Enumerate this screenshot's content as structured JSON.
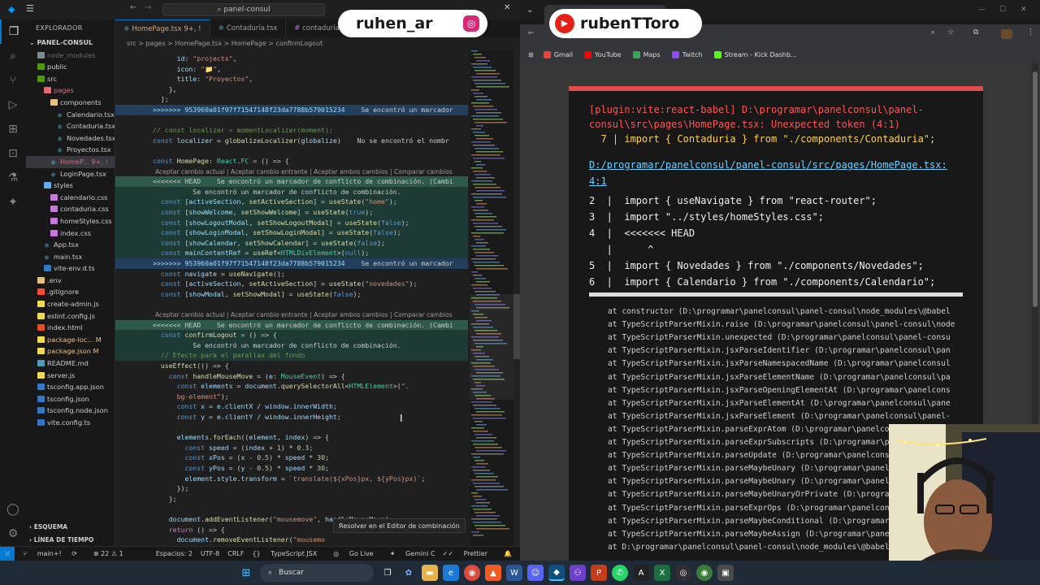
{
  "vscode": {
    "search": "panel-consul",
    "explorer_title": "EXPLORADOR",
    "project": "PANEL-CONSUL",
    "tree": [
      {
        "label": "node_modules",
        "indent": 1,
        "kind": "folder",
        "color": "#7f8c8d",
        "dim": true
      },
      {
        "label": "public",
        "indent": 1,
        "kind": "folder",
        "color": "#4e9a06"
      },
      {
        "label": "src",
        "indent": 1,
        "kind": "folder",
        "color": "#4e9a06",
        "open": true
      },
      {
        "label": "pages",
        "indent": 2,
        "kind": "folder",
        "color": "#e06c75",
        "open": true,
        "red": true
      },
      {
        "label": "components",
        "indent": 3,
        "kind": "folder",
        "color": "#e5c07b",
        "open": true
      },
      {
        "label": "Calendario.tsx",
        "indent": 4,
        "kind": "react"
      },
      {
        "label": "Contaduria.tsx",
        "indent": 4,
        "kind": "react"
      },
      {
        "label": "Novedades.tsx",
        "indent": 4,
        "kind": "react"
      },
      {
        "label": "Proyectos.tsx",
        "indent": 4,
        "kind": "react"
      },
      {
        "label": "HomeP... 9+, !",
        "indent": 3,
        "kind": "react",
        "selected": true,
        "red": true
      },
      {
        "label": "LoginPage.tsx",
        "indent": 3,
        "kind": "react"
      },
      {
        "label": "styles",
        "indent": 2,
        "kind": "folder",
        "color": "#61afef",
        "open": true
      },
      {
        "label": "calendario.css",
        "indent": 3,
        "kind": "css"
      },
      {
        "label": "contaduria.css",
        "indent": 3,
        "kind": "css"
      },
      {
        "label": "homeStyles.css",
        "indent": 3,
        "kind": "css"
      },
      {
        "label": "index.css",
        "indent": 3,
        "kind": "css"
      },
      {
        "label": "App.tsx",
        "indent": 2,
        "kind": "react"
      },
      {
        "label": "main.tsx",
        "indent": 2,
        "kind": "react"
      },
      {
        "label": "vite-env.d.ts",
        "indent": 2,
        "kind": "ts"
      },
      {
        "label": ".env",
        "indent": 1,
        "kind": "cfg"
      },
      {
        "label": ".gitignore",
        "indent": 1,
        "kind": "git"
      },
      {
        "label": "create-admin.js",
        "indent": 1,
        "kind": "js"
      },
      {
        "label": "eslint.config.js",
        "indent": 1,
        "kind": "js"
      },
      {
        "label": "index.html",
        "indent": 1,
        "kind": "html"
      },
      {
        "label": "package-loc... M",
        "indent": 1,
        "kind": "json",
        "mod": true
      },
      {
        "label": "package.json  M",
        "indent": 1,
        "kind": "json",
        "mod": true
      },
      {
        "label": "README.md",
        "indent": 1,
        "kind": "md"
      },
      {
        "label": "server.js",
        "indent": 1,
        "kind": "js"
      },
      {
        "label": "tsconfig.app.json",
        "indent": 1,
        "kind": "ts"
      },
      {
        "label": "tsconfig.json",
        "indent": 1,
        "kind": "ts"
      },
      {
        "label": "tsconfig.node.json",
        "indent": 1,
        "kind": "ts"
      },
      {
        "label": "vite.config.ts",
        "indent": 1,
        "kind": "ts"
      }
    ],
    "outline_label": "ESQUEMA",
    "timeline_label": "LÍNEA DE TIEMPO",
    "tabs": [
      "HomePage.tsx 9+, !",
      "Contaduria.tsx",
      "contaduria"
    ],
    "breadcrumb": "src > pages > HomePage.tsx > HomePage > confirmLogout",
    "conflict_actions": "Aceptar cambio actual | Aceptar cambio entrante | Aceptar ambos cambios | Comparar cambios",
    "conflict_msg": "Se encontró un marcador de conflicto de combinación.",
    "merge_button": "Resolver en el Editor de combinación",
    "status": {
      "branch": "main+!",
      "sync": "⟳",
      "problems": "⊗ 22 ⚠ 1",
      "spaces": "Espacios: 2",
      "encoding": "UTF-8",
      "eol": "CRLF",
      "lang": "TypeScript JSX",
      "golive": "Go Live",
      "gemini": "Gemini Code Assist: Indexing workspace...",
      "prettier": "Prettier"
    },
    "code_lines": [
      {
        "n": "",
        "h": "",
        "html": "      <span class='v'>id</span>: <span class='s'>\"projects\"</span>,"
      },
      {
        "n": "",
        "h": "",
        "html": "      <span class='v'>icon</span>: <span class='s'>\"📁\"</span>,"
      },
      {
        "n": "",
        "h": "",
        "html": "      <span class='v'>title</span>: <span class='s'>\"Proyectos\"</span>,"
      },
      {
        "n": "",
        "h": "",
        "html": "    },"
      },
      {
        "n": "",
        "h": "",
        "html": "  ];"
      },
      {
        "n": "",
        "h": "hinc",
        "html": "<span class='v'>&gt;&gt;&gt;&gt;&gt;&gt;&gt; 953960a01f97f71547148f23da7788b579015234</span>    <span class='err'>Se encontró un marcador</span>"
      },
      {
        "n": "",
        "h": "",
        "html": ""
      },
      {
        "n": "",
        "h": "",
        "html": "<span class='c'>// const localizer = momentLocalizer(moment);</span>"
      },
      {
        "n": "",
        "h": "",
        "html": "<span class='k'>const</span> <span class='v'>localizer</span> = <span class='f'>globalizeLocalizer</span>(<span class='v'>globalize</span>)    <span class='err'>No se encontró el nombr</span>"
      },
      {
        "n": "",
        "h": "",
        "html": ""
      },
      {
        "n": "",
        "h": "",
        "html": "<span class='k'>const</span> <span class='f'>HomePage</span>: <span class='t'>React</span>.<span class='t'>FC</span> = () =&gt; {"
      },
      {
        "n": "",
        "h": "gap",
        "html": ""
      },
      {
        "n": "",
        "h": "hcur",
        "html": "<span class='err'>&lt;&lt;&lt;&lt;&lt;&lt;&lt; HEAD    Se encontró un marcador de conflicto de combinación. (Cambi</span>"
      },
      {
        "n": "",
        "h": "hcurb",
        "html": "<span class='err'>          Se encontró un marcador de conflicto de combinación.</span>"
      },
      {
        "n": "",
        "h": "hcurb",
        "html": "  <span class='k'>const</span> [<span class='v'>activeSection</span>, <span class='f'>setActiveSection</span>] = <span class='f'>useState</span>(<span class='s'>\"home\"</span>);"
      },
      {
        "n": "",
        "h": "hcurb",
        "html": "  <span class='k'>const</span> [<span class='v'>showWelcome</span>, <span class='f'>setShowWelcome</span>] = <span class='f'>useState</span>(<span class='k'>true</span>);"
      },
      {
        "n": "",
        "h": "hcurb",
        "html": "  <span class='k'>const</span> [<span class='v'>showLogoutModal</span>, <span class='f'>setShowLogoutModal</span>] = <span class='f'>useState</span>(<span class='k'>false</span>);"
      },
      {
        "n": "",
        "h": "hcurb",
        "html": "  <span class='k'>const</span> [<span class='v'>showLoginModal</span>, <span class='f'>setShowLoginModal</span>] = <span class='f'>useState</span>(<span class='k'>false</span>);"
      },
      {
        "n": "",
        "h": "hcurb",
        "html": "  <span class='k'>const</span> [<span class='v'>showCalendar</span>, <span class='f'>setShowCalendar</span>] = <span class='f'>useState</span>(<span class='k'>false</span>);"
      },
      {
        "n": "",
        "h": "hcurb",
        "html": "  <span class='k'>const</span> <span class='v'>mainContentRef</span> = <span class='f'>useRef</span>&lt;<span class='t'>HTMLDivElement</span>&gt;(<span class='k'>null</span>);"
      },
      {
        "n": "",
        "h": "hinc",
        "html": "<span class='v'>&gt;&gt;&gt;&gt;&gt;&gt;&gt; 953960a01f97f71547148f23da7788b579015234</span>    <span class='err'>Se encontró un marcador</span>"
      },
      {
        "n": "",
        "h": "",
        "html": "  <span class='k'>const</span> <span class='v'>navigate</span> = <span class='f'>useNavigate</span>();"
      },
      {
        "n": "",
        "h": "",
        "html": "  <span class='k'>const</span> [<span class='v'>activeSection</span>, <span class='f'>setActiveSection</span>] = <span class='f'>useState</span>(<span class='s'>\"novedades\"</span>);"
      },
      {
        "n": "",
        "h": "",
        "html": "  <span class='k'>const</span> [<span class='v'>showModal</span>, <span class='f'>setShowModal</span>] = <span class='f'>useState</span>(<span class='k'>false</span>);"
      },
      {
        "n": "",
        "h": "",
        "html": ""
      },
      {
        "n": "",
        "h": "gap",
        "html": ""
      },
      {
        "n": "",
        "h": "hcur",
        "html": "<span class='err'>&lt;&lt;&lt;&lt;&lt;&lt;&lt; HEAD    Se encontró un marcador de conflicto de combinación. (Cambi</span>"
      },
      {
        "n": "",
        "h": "hcurb",
        "html": "  <span class='k'>const</span> <span class='f'>confirmLogout</span> = () =&gt; {"
      },
      {
        "n": "",
        "h": "hcurb",
        "html": "<span class='err'>          Se encontró un marcador de conflicto de combinación.</span>"
      },
      {
        "n": "",
        "h": "hcurb",
        "html": "  <span class='c'>// Efecto para el parallax del fondo</span>"
      },
      {
        "n": "",
        "h": "",
        "html": "  <span class='f'>useEffect</span>(() =&gt; {"
      },
      {
        "n": "",
        "h": "",
        "html": "    <span class='k'>const</span> <span class='f'>handleMouseMove</span> = (<span class='v'>e</span>: <span class='t'>MouseEvent</span>) =&gt; {"
      },
      {
        "n": "",
        "h": "",
        "html": "      <span class='k'>const</span> <span class='v'>elements</span> = <span class='v'>document</span>.<span class='f'>querySelectorAll</span>&lt;<span class='t'>HTMLElement</span>&gt;(<span class='s'>\".</span>"
      },
      {
        "n": "",
        "h": "",
        "html": "      <span class='s'>bg-element\"</span>);"
      },
      {
        "n": "",
        "h": "",
        "html": "      <span class='k'>const</span> <span class='v'>x</span> = <span class='v'>e</span>.<span class='v'>clientX</span> / <span class='v'>window</span>.<span class='v'>innerWidth</span>;"
      },
      {
        "n": "",
        "h": "",
        "html": "      <span class='k'>const</span> <span class='v'>y</span> = <span class='v'>e</span>.<span class='v'>clientY</span> / <span class='v'>window</span>.<span class='v'>innerHeight</span>;"
      },
      {
        "n": "",
        "h": "",
        "html": ""
      },
      {
        "n": "",
        "h": "",
        "html": "      <span class='v'>elements</span>.<span class='f'>forEach</span>((<span class='v'>element</span>, <span class='v'>index</span>) =&gt; {"
      },
      {
        "n": "",
        "h": "",
        "html": "        <span class='k'>const</span> <span class='v'>speed</span> = (<span class='v'>index</span> + <span class='n'>1</span>) * <span class='n'>0.3</span>;"
      },
      {
        "n": "",
        "h": "",
        "html": "        <span class='k'>const</span> <span class='v'>xPos</span> = (<span class='v'>x</span> - <span class='n'>0.5</span>) * <span class='v'>speed</span> * <span class='n'>30</span>;"
      },
      {
        "n": "",
        "h": "",
        "html": "        <span class='k'>const</span> <span class='v'>yPos</span> = (<span class='v'>y</span> - <span class='n'>0.5</span>) * <span class='v'>speed</span> * <span class='n'>30</span>;"
      },
      {
        "n": "",
        "h": "",
        "html": "        <span class='v'>element</span>.<span class='v'>style</span>.<span class='v'>transform</span> = <span class='s'>`translate(${xPos}px, ${yPos}px)`</span>;"
      },
      {
        "n": "",
        "h": "",
        "html": "      });"
      },
      {
        "n": "",
        "h": "",
        "html": "    };"
      },
      {
        "n": "",
        "h": "",
        "html": ""
      },
      {
        "n": "",
        "h": "",
        "html": "    <span class='v'>document</span>.<span class='f'>addEventListener</span>(<span class='s'>\"mousemove\"</span>, <span class='v'>handleMouseMove</span>);"
      },
      {
        "n": "",
        "h": "",
        "html": "    <span class='p'>return</span> () =&gt; {"
      },
      {
        "n": "",
        "h": "",
        "html": "      <span class='v'>document</span>.<span class='f'>removeEventListener</span>(<span class='s'>\"mousemo</span>"
      },
      {
        "n": "",
        "h": "",
        "html": "    };"
      }
    ]
  },
  "browser": {
    "bookmarks": [
      {
        "label": "Gmail",
        "color": "#ea4335"
      },
      {
        "label": "YouTube",
        "color": "#ff0000"
      },
      {
        "label": "Maps",
        "color": "#34a853"
      },
      {
        "label": "Twitch",
        "color": "#9146ff"
      },
      {
        "label": "Stream - Kick Dashb...",
        "color": "#53fc18"
      }
    ],
    "error_title": "[plugin:vite:react-babel] D:\\programar\\panelconsul\\panel-\nconsul\\src\\pages\\HomePage.tsx: Unexpected token (4:1)\n  7 | import { Contaduria } from \"./components/Contaduria\";",
    "error_title_l1": "[plugin:vite:react-babel] D:\\programar\\panelconsul\\panel-",
    "error_title_l2": "consul\\src\\pages\\HomePage.tsx: Unexpected token (4:1)",
    "error_title_l3": "  7 | import { Contaduria } from \"./components/Contaduria\";",
    "file_link_l1": "D:/programar/panelconsul/panel-consul/src/pages/HomePage.tsx:",
    "file_link_l2": "4:1",
    "snippet": [
      "2  |  import { useNavigate } from \"react-router\";",
      "3  |  import \"../styles/homeStyles.css\";",
      "4  |  <<<<<<< HEAD",
      "   |      ^",
      "5  |  import { Novedades } from \"./components/Novedades\";",
      "6  |  import { Calendario } from \"./components/Calendario\";"
    ],
    "stack": [
      "at constructor (D:\\programar\\panelconsul\\panel-consul\\node_modules\\@babel",
      "at TypeScriptParserMixin.raise (D:\\programar\\panelconsul\\panel-consul\\node",
      "at TypeScriptParserMixin.unexpected (D:\\programar\\panelconsul\\panel-consu",
      "at TypeScriptParserMixin.jsxParseIdentifier (D:\\programar\\panelconsul\\pan",
      "at TypeScriptParserMixin.jsxParseNamespacedName (D:\\programar\\panelconsul",
      "at TypeScriptParserMixin.jsxParseElementName (D:\\programar\\panelconsul\\pa",
      "at TypeScriptParserMixin.jsxParseOpeningElementAt (D:\\programar\\panelcons",
      "at TypeScriptParserMixin.jsxParseElementAt (D:\\programar\\panelconsul\\pane",
      "at TypeScriptParserMixin.jsxParseElement (D:\\programar\\panelconsul\\panel-",
      "at TypeScriptParserMixin.parseExprAtom (D:\\programar\\panelconsul\\panel-c",
      "at TypeScriptParserMixin.parseExprSubscripts (D:\\programar\\panelconsul\\p",
      "at TypeScriptParserMixin.parseUpdate (D:\\programar\\panelconsul\\panel-con",
      "at TypeScriptParserMixin.parseMaybeUnary (D:\\programar\\panelconsul\\panel",
      "at TypeScriptParserMixin.parseMaybeUnary (D:\\programar\\panelconsul\\panel",
      "at TypeScriptParserMixin.parseMaybeUnaryOrPrivate (D:\\programar\\panelcons",
      "at TypeScriptParserMixin.parseExprOps (D:\\programar\\panelconsul\\panel-co",
      "at TypeScriptParserMixin.parseMaybeConditional (D:\\programar\\panelconsul",
      "at TypeScriptParserMixin.parseMaybeAssign (D:\\programar\\panelconsul\\pane",
      "at D:\\programar\\panelconsul\\panel-consul\\node_modules\\@babel\\parser\\lib"
    ]
  },
  "overlays": {
    "left_name": "ruhen_ar",
    "right_name": "rubenTToro"
  },
  "taskbar": {
    "search_label": "Buscar"
  }
}
